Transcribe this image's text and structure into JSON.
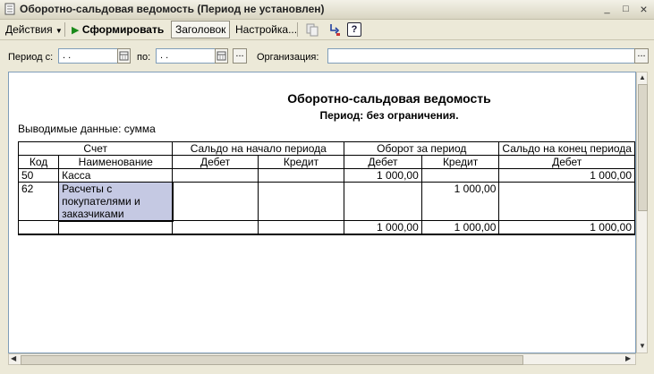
{
  "window": {
    "title": "Оборотно-сальдовая ведомость (Период не установлен)",
    "minimize": "_",
    "maximize": "□",
    "close": "×"
  },
  "toolbar": {
    "actions_label": "Действия",
    "generate_label": "Сформировать",
    "header_label": "Заголовок",
    "settings_label": "Настройка...",
    "help_label": "?"
  },
  "params": {
    "period_from_label": "Период с:",
    "period_from_value": " .  .",
    "period_to_label": "по:",
    "period_to_value": " .  .",
    "period_btn": "...",
    "org_label": "Организация:",
    "org_value": "",
    "org_btn": "..."
  },
  "report": {
    "title": "Оборотно-сальдовая ведомость",
    "period": "Период: без ограничения.",
    "data_label": "Выводимые данные: сумма",
    "header_groups": [
      "Счет",
      "Сальдо на начало периода",
      "Оборот за период",
      "Сальдо на конец периода"
    ],
    "columns": [
      "Код",
      "Наименование",
      "Дебет",
      "Кредит",
      "Дебет",
      "Кредит",
      "Дебет"
    ],
    "rows": [
      {
        "code": "50",
        "name": "Касса",
        "sd": "",
        "sc": "",
        "od": "1 000,00",
        "oc": "",
        "ed": "1 000,00"
      },
      {
        "code": "62",
        "name": "Расчеты с покупателями и заказчиками",
        "sd": "",
        "sc": "",
        "od": "",
        "oc": "1 000,00",
        "ed": ""
      }
    ],
    "totals": {
      "od": "1 000,00",
      "oc": "1 000,00",
      "ed": "1 000,00"
    }
  },
  "colors": {
    "selection": "#C5C9E3",
    "window_bg": "#ECE9D8",
    "field_border": "#7F9DB9"
  }
}
